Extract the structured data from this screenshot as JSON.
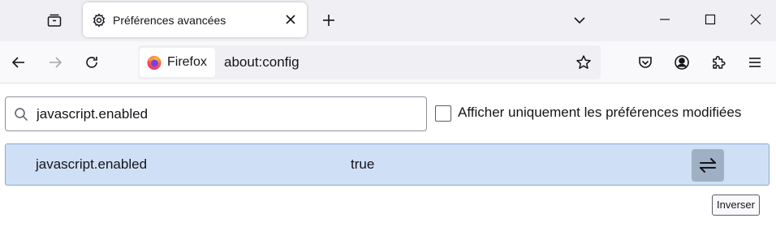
{
  "browser": {
    "tab": {
      "title": "Préférences avancées",
      "icon": "gear-icon"
    },
    "icons": {
      "list_all_tabs": "tab-list-icon",
      "new_tab": "plus-icon",
      "all_tabs_menu": "chevron-down-icon",
      "minimize": "minimize-icon",
      "maximize": "maximize-icon",
      "close": "close-icon"
    }
  },
  "navbar": {
    "identity_label": "Firefox",
    "url": "about:config",
    "icons": [
      "back-arrow-icon",
      "forward-arrow-icon",
      "reload-icon",
      "bookmark-star-icon",
      "pocket-icon",
      "account-icon",
      "extensions-icon",
      "hamburger-menu-icon"
    ]
  },
  "config": {
    "search": {
      "value": "javascript.enabled"
    },
    "modified_only": {
      "label": "Afficher uniquement les préférences modifiées",
      "checked": false
    },
    "preferences": [
      {
        "name": "javascript.enabled",
        "value": "true"
      }
    ],
    "toggle_tooltip": "Inverser"
  },
  "colors": {
    "accent": "#0060df",
    "row_highlight": "#cfe0f6",
    "toggle_bg": "#9fb0c4"
  }
}
